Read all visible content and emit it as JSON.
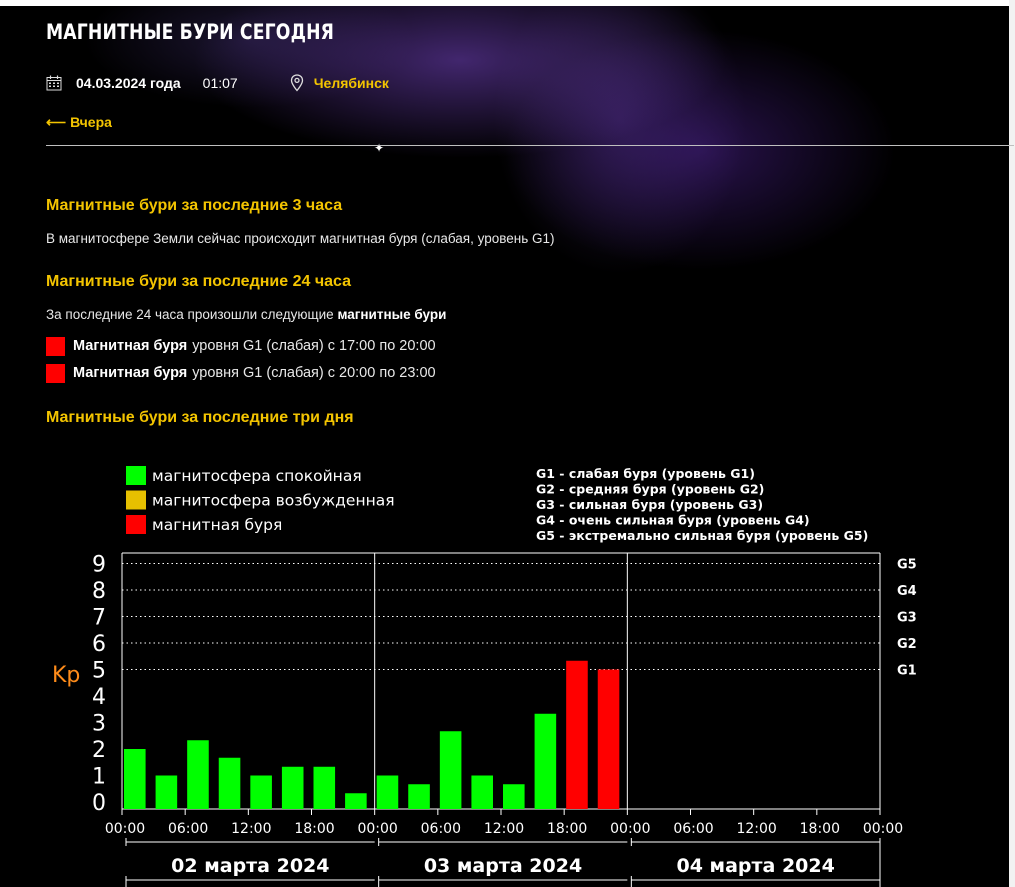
{
  "header": {
    "title": "МАГНИТНЫЕ БУРИ СЕГОДНЯ",
    "date": "04.03.2024 года",
    "time": "01:07",
    "city": "Челябинск",
    "back_label": "Вчера",
    "back_arrow": "⟵"
  },
  "sections": {
    "last3h": {
      "heading": "Магнитные бури за последние 3 часа",
      "text": "В магнитосфере Земли сейчас происходит магнитная буря (слабая, уровень G1)"
    },
    "last24h": {
      "heading": "Магнитные бури за последние 24 часа",
      "text_prefix": "За последние 24 часа произошли следующие ",
      "text_bold": "магнитные бури",
      "storms": [
        {
          "bold": "Магнитная буря",
          "rest": "уровня G1 (слабая) с 17:00 по 20:00"
        },
        {
          "bold": "Магнитная буря",
          "rest": "уровня G1 (слабая) с 20:00 по 23:00"
        }
      ],
      "storm_color": "#ff0000"
    },
    "last3d": {
      "heading": "Магнитные бури за последние три дня"
    }
  },
  "colors": {
    "accent": "#f3c400",
    "quiet": "#00ff00",
    "active": "#e6c000",
    "storm": "#ff0000",
    "kp_label": "#ff8c1a"
  },
  "chart_data": {
    "type": "bar",
    "ylabel": "Kp",
    "ylim": [
      0,
      9
    ],
    "yticks": [
      "0",
      "1",
      "2",
      "3",
      "4",
      "5",
      "6",
      "7",
      "8",
      "9"
    ],
    "g_levels": [
      {
        "label": "G1",
        "kp": 5
      },
      {
        "label": "G2",
        "kp": 6
      },
      {
        "label": "G3",
        "kp": 7
      },
      {
        "label": "G4",
        "kp": 8
      },
      {
        "label": "G5",
        "kp": 9
      }
    ],
    "legend": [
      {
        "label": "магнитосфера спокойная",
        "color": "#00ff00"
      },
      {
        "label": "магнитосфера возбужденная",
        "color": "#e6c000"
      },
      {
        "label": "магнитная буря",
        "color": "#ff0000"
      }
    ],
    "g_legend": [
      "G1 - слабая буря (уровень G1)",
      "G2 - средняя буря (уровень G2)",
      "G3 - сильная буря (уровень G3)",
      "G4 - очень сильная буря (уровень G4)",
      "G5 - экстремально сильная буря (уровень G5)"
    ],
    "xticks": [
      "00:00",
      "06:00",
      "12:00",
      "18:00",
      "00:00",
      "06:00",
      "12:00",
      "18:00",
      "00:00",
      "06:00",
      "12:00",
      "18:00",
      "00:00"
    ],
    "days": [
      "02 марта 2024",
      "03 марта 2024",
      "04 марта 2024"
    ],
    "values": [
      2.0,
      1.0,
      2.33,
      1.67,
      1.0,
      1.33,
      1.33,
      0.33,
      1.0,
      0.67,
      2.67,
      1.0,
      0.67,
      3.33,
      5.33,
      5.0
    ],
    "bar_colors": [
      "#00ff00",
      "#00ff00",
      "#00ff00",
      "#00ff00",
      "#00ff00",
      "#00ff00",
      "#00ff00",
      "#00ff00",
      "#00ff00",
      "#00ff00",
      "#00ff00",
      "#00ff00",
      "#00ff00",
      "#00ff00",
      "#ff0000",
      "#ff0000"
    ],
    "slots_total": 24,
    "grid": true
  }
}
